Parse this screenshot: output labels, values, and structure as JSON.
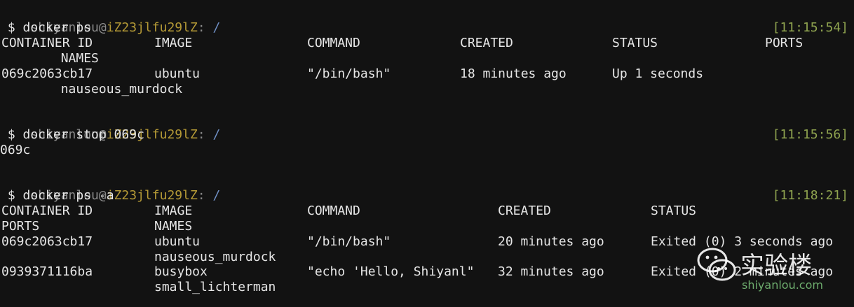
{
  "prompt": {
    "user": "shiyanlou",
    "at": "@",
    "host": "iZ23jlfu29lZ",
    "colon": ":",
    "path": " /"
  },
  "blocks": [
    {
      "command": " $ docker ps",
      "time": "[11:15:54]",
      "output": {
        "headers": [
          "CONTAINER ID",
          "IMAGE",
          "COMMAND",
          "CREATED",
          "STATUS",
          "PORTS"
        ],
        "headers2": "        NAMES",
        "row1": [
          "069c2063cb17",
          "ubuntu",
          "\"/bin/bash\"",
          "18 minutes ago",
          "Up 1 seconds"
        ],
        "row1b": "        nauseous_murdock"
      }
    },
    {
      "command": " $ docker stop 069c",
      "time": "[11:15:56]",
      "output": {
        "text": "069c"
      }
    },
    {
      "command": " $ docker ps -a",
      "time": "[11:18:21]",
      "output": {
        "headers": [
          "CONTAINER ID",
          "IMAGE",
          "COMMAND",
          "CREATED",
          "STATUS"
        ],
        "headers2": [
          "PORTS",
          "NAMES"
        ],
        "row1": [
          "069c2063cb17",
          "ubuntu",
          "\"/bin/bash\"",
          "20 minutes ago",
          "Exited (0) 3 seconds ago"
        ],
        "row1b": "nauseous_murdock",
        "row2": [
          "0939371116ba",
          "busybox",
          "\"echo 'Hello, Shiyanl\"",
          "32 minutes ago",
          "Exited (0) 2 minutes ago"
        ],
        "row2b": "small_lichterman"
      }
    }
  ],
  "watermark": {
    "title": "实验楼",
    "subtitle": "shiyanlou.com",
    "icon": "wechat-icon"
  }
}
